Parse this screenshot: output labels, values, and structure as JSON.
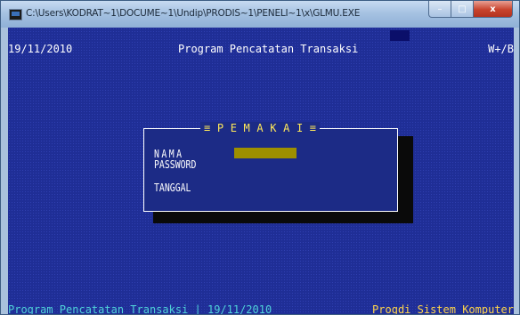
{
  "window": {
    "title": "C:\\Users\\KODRAT~1\\DOCUME~1\\Undip\\PRODIS~1\\PENELI~1\\x\\GLMU.EXE",
    "buttons": {
      "minimize": "–",
      "maximize": "□",
      "close": "x"
    }
  },
  "console": {
    "top_left": "19/11/2010",
    "top_center": "Program Pencatatan Transaksi",
    "top_right": "W+/B",
    "bottom_left": "Program Pencatatan Transaksi | 19/11/2010",
    "bottom_right": "Progdi Sistem Komputer"
  },
  "dialog": {
    "title": "≡ P E M A K A I ≡",
    "nama_label": "NAMA",
    "password_label": "PASSWORD",
    "tanggal_label": "TANGGAL",
    "nama_value": ""
  },
  "colors": {
    "console_bg": "#1f2e96",
    "dialog_title": "#ffe85a",
    "status_left": "#4fd2d8",
    "status_right": "#ffd54a",
    "input_field": "#9d8f00"
  }
}
